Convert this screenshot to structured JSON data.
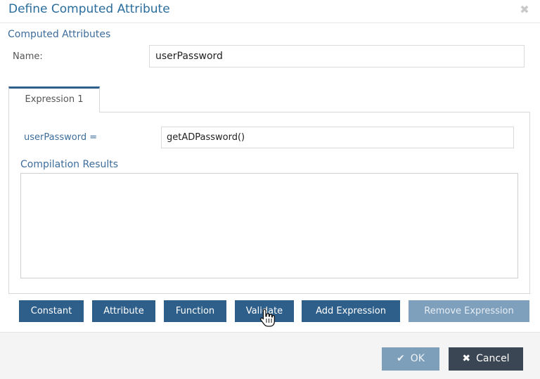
{
  "dialog": {
    "title": "Define Computed Attribute"
  },
  "computed": {
    "section_label": "Computed Attributes",
    "name_label": "Name:",
    "name_value": "userPassword"
  },
  "tabs": [
    {
      "label": "Expression 1"
    }
  ],
  "expression": {
    "label": "userPassword =",
    "value": "getADPassword()"
  },
  "compilation": {
    "label": "Compilation Results",
    "value": ""
  },
  "buttons": {
    "constant": "Constant",
    "attribute": "Attribute",
    "function": "Function",
    "validate": "Validate",
    "add_expression": "Add Expression",
    "remove_expression": "Remove Expression"
  },
  "footer": {
    "ok_label": "OK",
    "cancel_label": "Cancel"
  },
  "icons": {
    "close": "close-icon",
    "ok": "check-icon",
    "cancel": "x-icon",
    "cursor": "hand-pointer-icon"
  },
  "colors": {
    "title": "#2a6d9c",
    "button": "#2e5f8a",
    "button_disabled": "#7fa0bd",
    "cancel": "#3b4654"
  }
}
